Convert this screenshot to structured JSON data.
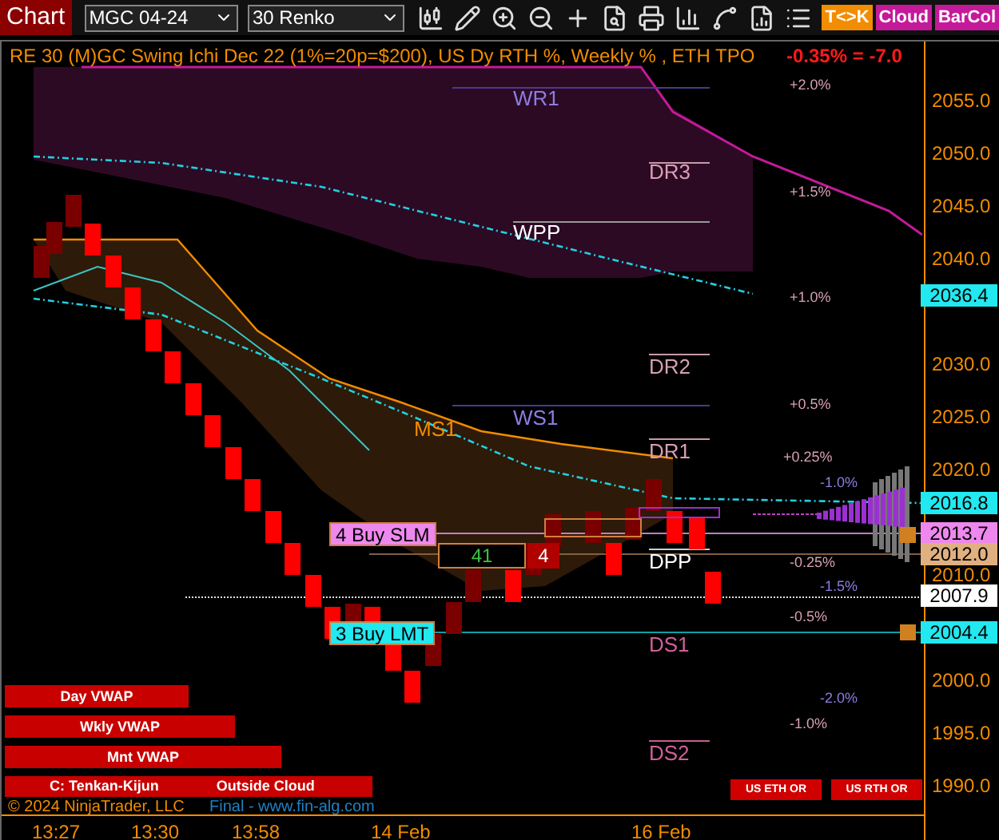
{
  "toolbar": {
    "title": "Chart",
    "instrument": "MGC 04-24",
    "bar_type": "30 Renko",
    "toggles": [
      {
        "label": "T<>K",
        "color": "#f28c00"
      },
      {
        "label": "Cloud",
        "color": "#c41a9a"
      },
      {
        "label": "BarCol",
        "color": "#c41a9a"
      }
    ]
  },
  "chart": {
    "title": "RE 30 (M)GC Swing Ichi Dec 22 (1%=20p=$200), US Dy RTH %, Weekly % , ETH TPO",
    "change": "-0.35% = -7.0",
    "levels": [
      {
        "label": "WR1",
        "color": "#8a7ee0"
      },
      {
        "label": "DR3",
        "color": "#d8a0b4"
      },
      {
        "label": "WPP",
        "color": "#ffffff"
      },
      {
        "label": "DR2",
        "color": "#d8a0b4"
      },
      {
        "label": "WS1",
        "color": "#8a7ee0"
      },
      {
        "label": "MS1",
        "color": "#f28c00"
      },
      {
        "label": "DR1",
        "color": "#d8a0b4"
      },
      {
        "label": "DPP",
        "color": "#ffffff"
      },
      {
        "label": "DS1",
        "color": "#d0609a"
      },
      {
        "label": "DS2",
        "color": "#d0609a"
      }
    ],
    "percents": [
      {
        "label": "+2.0%",
        "color": "#d8a0b4"
      },
      {
        "label": "+1.5%",
        "color": "#d8a0b4"
      },
      {
        "label": "+1.0%",
        "color": "#d8a0b4"
      },
      {
        "label": "+0.5%",
        "color": "#d8a0b4"
      },
      {
        "label": "+0.25%",
        "color": "#d8a0b4"
      },
      {
        "label": "-1.0%",
        "color": "#8a7ee0"
      },
      {
        "label": "-0.25%",
        "color": "#d8a0b4"
      },
      {
        "label": "-1.5%",
        "color": "#8a7ee0"
      },
      {
        "label": "-0.5%",
        "color": "#d8a0b4"
      },
      {
        "label": "-2.0%",
        "color": "#8a7ee0"
      },
      {
        "label": "-1.0%",
        "color": "#d8a0b4"
      }
    ],
    "orders": [
      {
        "label": "4 Buy SLM",
        "color": "#ee88ee"
      },
      {
        "label": "3 Buy LMT",
        "color": "#22e8f0"
      }
    ],
    "position": {
      "quantity": "41",
      "pnl": "4"
    },
    "indicator_labels": [
      "Day VWAP",
      "Wkly VWAP",
      "Mnt VWAP"
    ],
    "cloud_label": {
      "left": "C: Tenkan-Kijun",
      "right": "Outside Cloud"
    },
    "session_buttons": [
      "US ETH OR",
      "US RTH OR"
    ],
    "copyright": "© 2024 NinjaTrader, LLC",
    "credit": "Final - www.fin-alg.com"
  },
  "price_axis": {
    "labels": [
      "2055.0",
      "2050.0",
      "2045.0",
      "2040.0",
      "2030.0",
      "2025.0",
      "2020.0",
      "2010.0",
      "2000.0",
      "1995.0",
      "1990.0"
    ],
    "tags": [
      {
        "label": "2036.4",
        "color": "#22e8f0"
      },
      {
        "label": "2016.8",
        "color": "#22e8f0"
      },
      {
        "label": "2013.7",
        "color": "#ee88ee"
      },
      {
        "label": "2012.0",
        "color": "#e0b080"
      },
      {
        "label": "2007.9",
        "color": "#ffffff"
      },
      {
        "label": "2004.4",
        "color": "#22e8f0"
      }
    ]
  },
  "time_axis": [
    "13:27",
    "13:30",
    "13:58",
    "14 Feb",
    "16 Feb"
  ]
}
